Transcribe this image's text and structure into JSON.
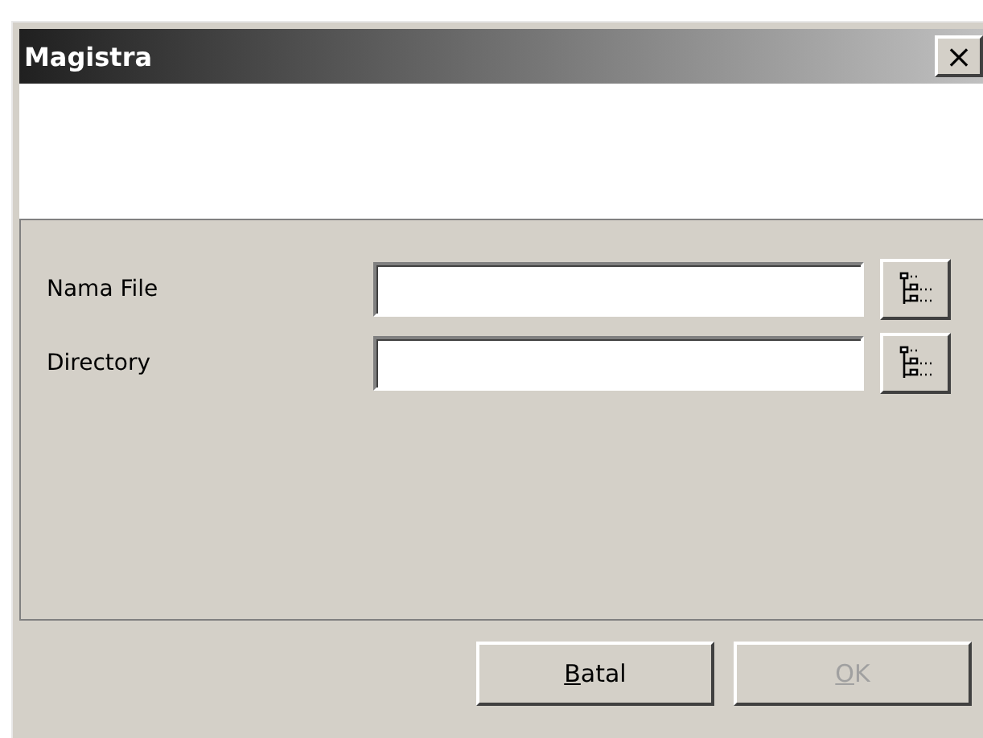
{
  "window": {
    "title": "Magistra",
    "close_glyph": "×"
  },
  "fields": [
    {
      "label": "Nama File"
    },
    {
      "label": "Directory"
    }
  ],
  "buttons": [
    {
      "label": "Batal",
      "disabled": false
    },
    {
      "label": "OK",
      "disabled": true
    }
  ]
}
